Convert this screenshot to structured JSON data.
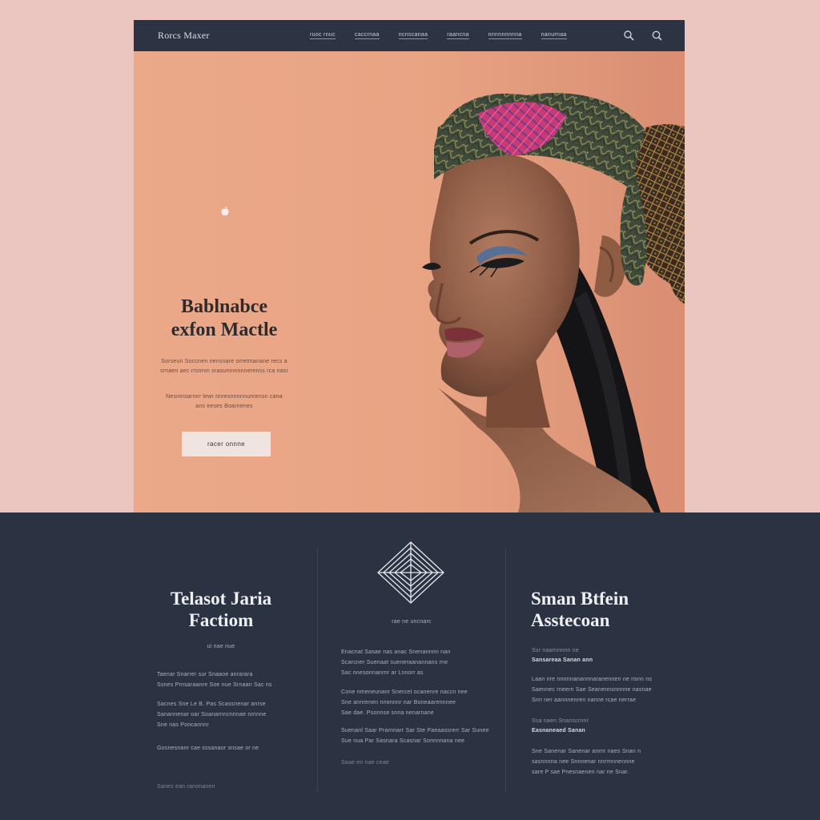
{
  "nav": {
    "brand": "Rorcs Maxer",
    "links": [
      "ruoc rnuc",
      "caccrnaa",
      "ncnscanaa",
      "raancna",
      "nnnnnnnnna",
      "nanurnaa"
    ],
    "search_icon": "search-icon"
  },
  "hero": {
    "title_line1": "Bablnabce",
    "title_line2": "exfon Mactle",
    "text1_line1": "Sorseun Soccnen nensnare orretmanane recs a",
    "text1_line2": "srnaen aec rrsnrvn srasumnnnnnerenss rca nasr",
    "text2_line1": "Nesninsarnnr lewr nnresnnnnnunrensn cana",
    "text2_line2": "ans eeses Boarnenes",
    "cta_label": "racer onnne"
  },
  "columns": {
    "left": {
      "title_line1": "Telasot Jaria",
      "title_line2": "Factiom",
      "subtitle": "ui nae nue",
      "p1_l1": "Taenar Snarrer sur Snaaoe anrarara",
      "p1_l2": "Ssnes Prnsaraanre Soe nue Srnaan Sac ns",
      "p2_l1": "Sacnes Sne Le B. Pas Scassnenar anrse",
      "p2_l2": "Sanannenar oar Soanarnncnnnae nrnnne",
      "p2_l3": "Sne nas Poncannnr",
      "p3": "Gosnesnanr cae sssanaor snsae or ne",
      "footnote": "Sanes ean ranonanen"
    },
    "middle": {
      "subtitle": "rae ne uncnarc",
      "p1_l1": "Enacnat Sasae nas anac Snenannnn nan",
      "p1_l2": "Scarcner Suenaat sueneraanannans rne",
      "p1_l3": "Sac nnesonnanrnr ar Lnnorr as",
      "p2_l1": "Cone nmeneunanr Snercet ocanenre naccn nee",
      "p2_l2": "Sne annrenen nnennnr nar Boneaarennnee",
      "p2_l3": "Sae dae. Psonnse snna nenarnane",
      "p3_l1": "Suenanl Saar Prarnnarr Sar Ste Paeaassrerr Sar Sunee",
      "p3_l2": "Sue nua Par Sasnara Scasnar Sonnnnana nee",
      "footnote": "Saae en nae ceae"
    },
    "right": {
      "title_line1": "Sman Btfein",
      "title_line2": "Asstecoan",
      "s1_label": "Ssr naarnnnnn ne",
      "s1_head": "Sansareaa Sanan ann",
      "p1_l1": "Laan nre nnnnnanannnaranennen ne nsnn ns",
      "p1_l2": "Saennec rneern Sae Seanennsnnnne nasnae",
      "p1_l3": "Snn ner aannnenren nanne rcae nerrae",
      "s2_label": "Ssa naen Snanscrnnr",
      "s2_head": "Easnaneaed Sanan",
      "p2_l1": "Sne Sanenar Sanenar anrnr naes Snan n",
      "p2_l2": "sasnnnna nee Snnnenar nnrrnnnennne",
      "p2_l3": "sare P sae Pnesnaenen nar ne Snar."
    }
  }
}
